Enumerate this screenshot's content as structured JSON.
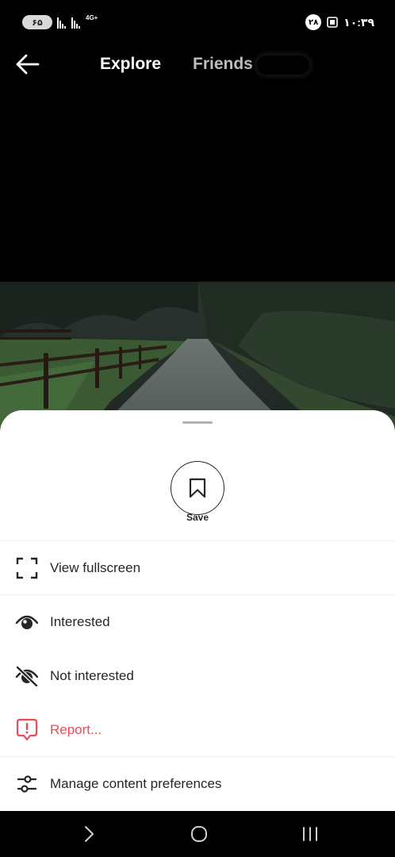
{
  "status_bar": {
    "battery": "۶۵",
    "network": "4G+",
    "notification_count": "۲۸",
    "time": "۱۰:۳۹"
  },
  "nav": {
    "tabs": [
      {
        "label": "Explore",
        "active": true
      },
      {
        "label": "Friends",
        "active": false
      }
    ]
  },
  "sheet": {
    "save_label": "Save",
    "items": [
      {
        "label": "View fullscreen",
        "icon": "fullscreen-icon"
      },
      {
        "label": "Interested",
        "icon": "eye-icon"
      },
      {
        "label": "Not interested",
        "icon": "eye-off-icon"
      },
      {
        "label": "Report...",
        "icon": "report-icon",
        "color": "#ed4956"
      },
      {
        "label": "Manage content preferences",
        "icon": "sliders-icon"
      }
    ]
  },
  "colors": {
    "danger": "#ed4956",
    "text": "#262626"
  }
}
